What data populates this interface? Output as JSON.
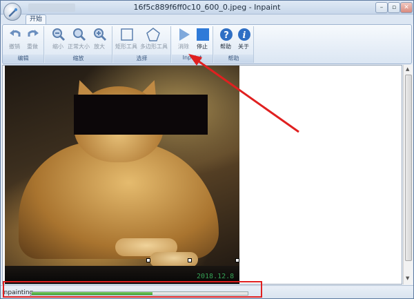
{
  "window": {
    "title": "16f5c889f6ff0c10_600_0.jpeg - Inpaint",
    "min_glyph": "–",
    "max_glyph": "▫",
    "close_glyph": "✕"
  },
  "ribbon": {
    "active_tab": "开始",
    "groups": [
      {
        "label": "编辑",
        "tools": [
          {
            "label": "撤销",
            "icon": "undo-icon",
            "enabled": false
          },
          {
            "label": "重做",
            "icon": "redo-icon",
            "enabled": false
          }
        ]
      },
      {
        "label": "缩放",
        "tools": [
          {
            "label": "缩小",
            "icon": "zoom-out-icon",
            "enabled": false
          },
          {
            "label": "正常大小",
            "icon": "zoom-normal-icon",
            "enabled": false
          },
          {
            "label": "放大",
            "icon": "zoom-in-icon",
            "enabled": false
          }
        ]
      },
      {
        "label": "选择",
        "tools": [
          {
            "label": "矩形工具",
            "icon": "rectangle-select-icon",
            "enabled": false
          },
          {
            "label": "多边形工具",
            "icon": "polygon-select-icon",
            "enabled": false
          }
        ]
      },
      {
        "label": "Inpaint",
        "tools": [
          {
            "label": "消除",
            "icon": "play-icon",
            "enabled": false
          },
          {
            "label": "停止",
            "icon": "stop-icon",
            "enabled": true
          }
        ]
      },
      {
        "label": "帮助",
        "tools": [
          {
            "label": "帮助",
            "icon": "help-icon",
            "enabled": true
          },
          {
            "label": "关于",
            "icon": "info-icon",
            "enabled": true
          }
        ]
      }
    ]
  },
  "canvas": {
    "date_stamp": "2018.12.8"
  },
  "status": {
    "text": "Inpainting",
    "progress_fraction": 0.56
  },
  "colors": {
    "annotation": "#e02020",
    "ribbon_blue": "#2f7ad8",
    "progress_green": "#3a9e2a"
  }
}
